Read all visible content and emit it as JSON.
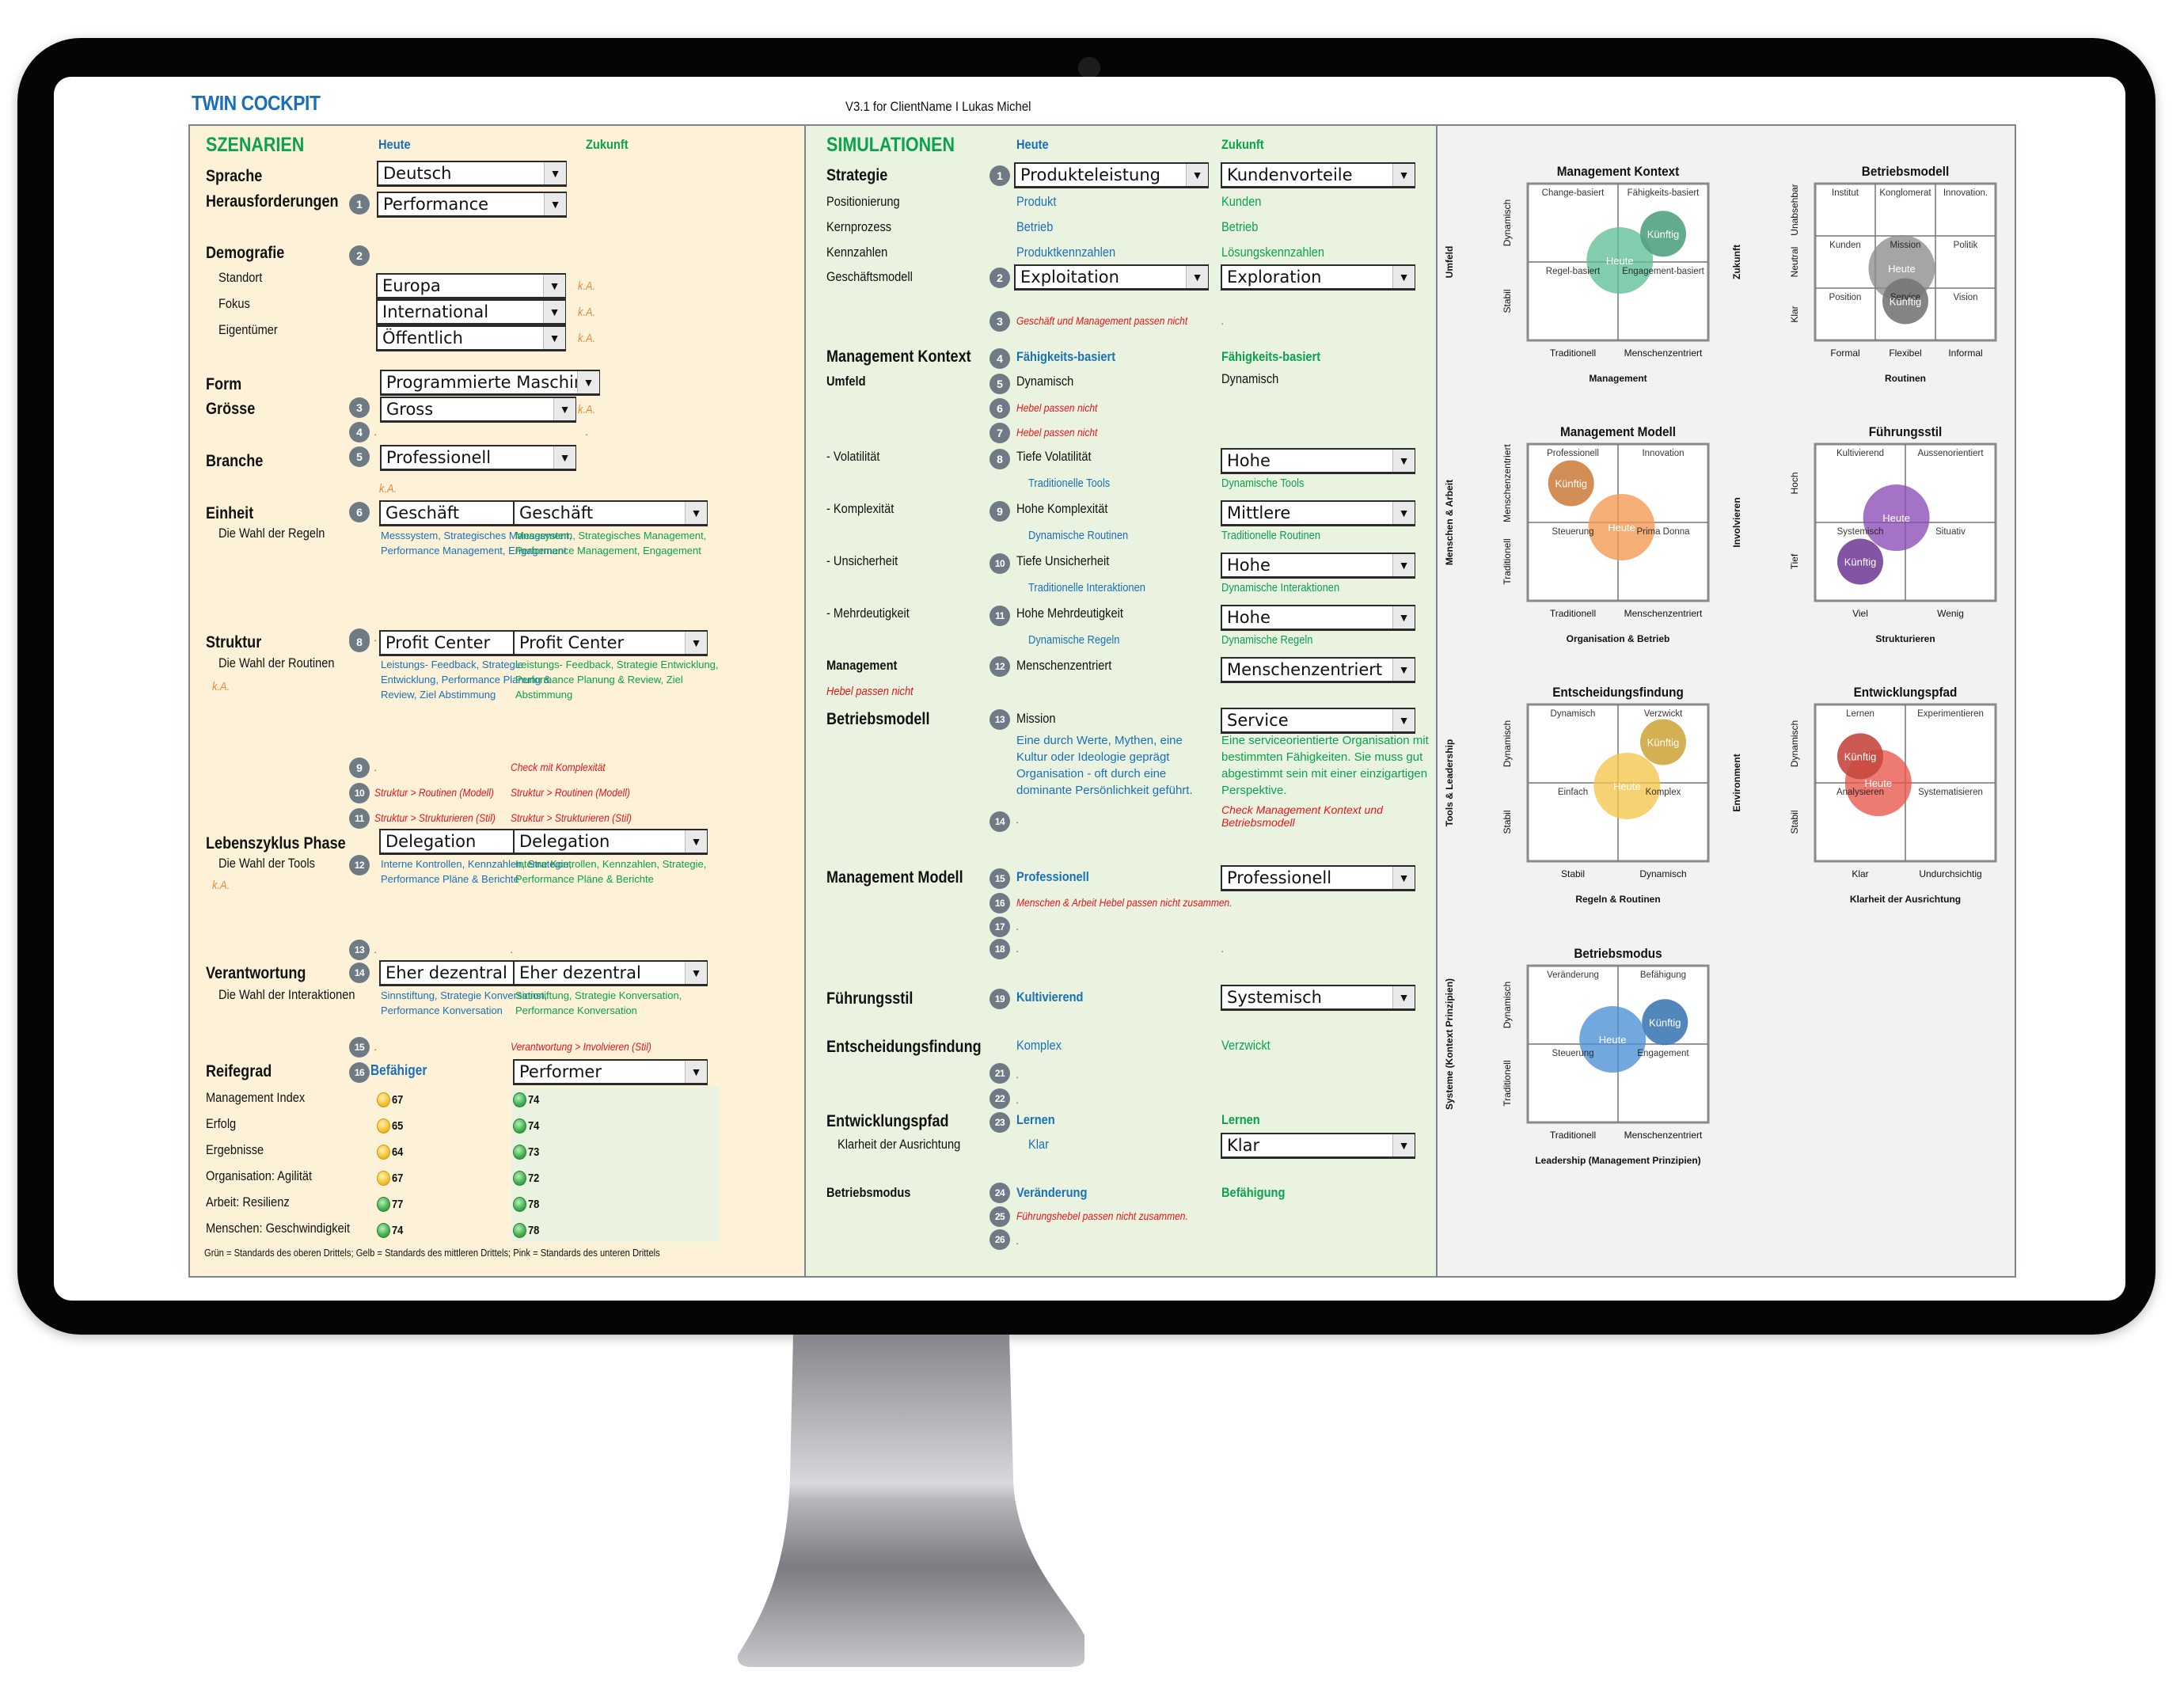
{
  "header": {
    "title": "TWIN COCKPIT",
    "version": "V3.1 for ClientName I Lukas Michel"
  },
  "szenarien": {
    "title": "SZENARIEN",
    "col_heute": "Heute",
    "col_zukunft": "Zukunft",
    "sprache": {
      "label": "Sprache",
      "value": "Deutsch"
    },
    "herausforderungen": {
      "label": "Herausforderungen",
      "badge": "1",
      "value": "Performance"
    },
    "demografie": {
      "label": "Demografie",
      "badge": "2",
      "rows": [
        {
          "label": "Standort",
          "value": "Europa",
          "note": "k.A."
        },
        {
          "label": "Fokus",
          "value": "International",
          "note": "k.A."
        },
        {
          "label": "Eigentümer",
          "value": "Öffentlich",
          "note": "k.A."
        }
      ]
    },
    "form": {
      "label": "Form",
      "value": "Programmierte Maschine"
    },
    "groesse": {
      "label": "Grösse",
      "badge": "3",
      "value": "Gross",
      "note": "k.A."
    },
    "row4": {
      "badge": "4",
      "heute": ".",
      "zukunft": "."
    },
    "branche": {
      "label": "Branche",
      "badge": "5",
      "value": "Professionell",
      "note": "k.A."
    },
    "einheit": {
      "label": "Einheit",
      "sublabel": "Die Wahl der Regeln",
      "badge": "6",
      "heute": "Geschäft",
      "zukunft": "Geschäft",
      "heute_desc": "Messsystem, Strategisches Management, Performance Management, Engagement",
      "zukunft_desc": "Messsystem, Strategisches Management, Performance Management, Engagement"
    },
    "row7": {
      "badge": "7",
      "heute": ".",
      "zukunft": "."
    },
    "struktur": {
      "label": "Struktur",
      "sublabel": "Die Wahl der Routinen",
      "badge": "8",
      "note": "k.A.",
      "heute": "Profit Center",
      "zukunft": "Profit Center",
      "heute_desc": "Leistungs- Feedback, Strategie Entwicklung, Performance Planung & Review, Ziel Abstimmung",
      "zukunft_desc": "Leistungs- Feedback, Strategie Entwicklung, Performance Planung & Review, Ziel Abstimmung"
    },
    "row9": {
      "badge": "9",
      "heute": ".",
      "zukunft": "Check mit Komplexität"
    },
    "row10": {
      "badge": "10",
      "heute": "Struktur > Routinen (Modell)",
      "zukunft": "Struktur > Routinen (Modell)"
    },
    "row11": {
      "badge": "11",
      "heute": "Struktur > Strukturieren (Stil)",
      "zukunft": "Struktur > Strukturieren (Stil)"
    },
    "lebenszyklus": {
      "label": "Lebenszyklus Phase",
      "sublabel": "Die Wahl der Tools",
      "badge": "12",
      "note": "k.A.",
      "heute": "Delegation",
      "zukunft": "Delegation",
      "heute_desc": "Interne Kontrollen, Kennzahlen, Strategie, Performance Pläne & Berichte",
      "zukunft_desc": "Interne Kontrollen, Kennzahlen, Strategie, Performance Pläne & Berichte"
    },
    "row13": {
      "badge": "13",
      "heute": ".",
      "zukunft": "."
    },
    "verantwortung": {
      "label": "Verantwortung",
      "sublabel": "Die Wahl der Interaktionen",
      "badge": "14",
      "heute": "Eher dezentral",
      "zukunft": "Eher dezentral",
      "heute_desc": "Sinnstiftung, Strategie Konversation, Performance Konversation",
      "zukunft_desc": "Sinnstiftung, Strategie Konversation, Performance Konversation"
    },
    "row15": {
      "badge": "15",
      "heute": ".",
      "zukunft": "Verantwortung > Involvieren (Stil)"
    },
    "reifegrad": {
      "label": "Reifegrad",
      "badge": "16",
      "heute": "Befähiger",
      "zukunft": "Performer",
      "metrics": [
        {
          "label": "Management Index",
          "heute": 67,
          "heute_status": "yellow",
          "zukunft": 74,
          "zukunft_status": "green"
        },
        {
          "label": "Erfolg",
          "heute": 65,
          "heute_status": "yellow",
          "zukunft": 74,
          "zukunft_status": "green"
        },
        {
          "label": "Ergebnisse",
          "heute": 64,
          "heute_status": "yellow",
          "zukunft": 73,
          "zukunft_status": "green"
        },
        {
          "label": "Organisation: Agilität",
          "heute": 67,
          "heute_status": "yellow",
          "zukunft": 72,
          "zukunft_status": "green"
        },
        {
          "label": "Arbeit: Resilienz",
          "heute": 77,
          "heute_status": "green",
          "zukunft": 78,
          "zukunft_status": "green"
        },
        {
          "label": "Menschen: Geschwindigkeit",
          "heute": 74,
          "heute_status": "green",
          "zukunft": 78,
          "zukunft_status": "green"
        }
      ],
      "legend": "Grün = Standards des oberen Drittels; Gelb = Standards des mittleren Drittels; Pink = Standards des unteren Drittels"
    }
  },
  "simulationen": {
    "title": "SIMULATIONEN",
    "col_heute": "Heute",
    "col_zukunft": "Zukunft",
    "strategie": {
      "label": "Strategie",
      "badge": "1",
      "heute": "Produkteleistung",
      "zukunft": "Kundenvorteile"
    },
    "positionierung": {
      "label": "Positionierung",
      "heute": "Produkt",
      "zukunft": "Kunden"
    },
    "kernprozess": {
      "label": "Kernprozess",
      "heute": "Betrieb",
      "zukunft": "Betrieb"
    },
    "kennzahlen": {
      "label": "Kennzahlen",
      "heute": "Produktkennzahlen",
      "zukunft": "Lösungskennzahlen"
    },
    "geschaeftsmodell": {
      "label": "Geschäftsmodell",
      "badge": "2",
      "heute": "Exploitation",
      "zukunft": "Exploration"
    },
    "row3": {
      "badge": "3",
      "heute": "Geschäft und Management passen nicht",
      "zukunft": "."
    },
    "management_kontext": {
      "label": "Management Kontext",
      "badge": "4",
      "heute": "Fähigkeits-basiert",
      "zukunft": "Fähigkeits-basiert"
    },
    "umfeld": {
      "label": "Umfeld",
      "badge": "5",
      "heute": "Dynamisch",
      "zukunft": "Dynamisch"
    },
    "row6": {
      "badge": "6",
      "heute": "Hebel passen nicht"
    },
    "row7": {
      "badge": "7",
      "heute": "Hebel passen nicht"
    },
    "volatilitaet": {
      "label": "- Volatilität",
      "badge": "8",
      "heute": "Tiefe Volatilität",
      "zukunft": "Hohe",
      "heute_sub": "Traditionelle Tools",
      "zukunft_sub": "Dynamische Tools"
    },
    "komplexitaet": {
      "label": "- Komplexität",
      "badge": "9",
      "heute": "Hohe Komplexität",
      "zukunft": "Mittlere",
      "heute_sub": "Dynamische Routinen",
      "zukunft_sub": "Traditionelle Routinen"
    },
    "unsicherheit": {
      "label": "- Unsicherheit",
      "badge": "10",
      "heute": "Tiefe Unsicherheit",
      "zukunft": "Hohe",
      "heute_sub": "Traditionelle Interaktionen",
      "zukunft_sub": "Dynamische Interaktionen"
    },
    "mehrdeutigkeit": {
      "label": "- Mehrdeutigkeit",
      "badge": "11",
      "heute": "Hohe Mehrdeutigkeit",
      "zukunft": "Hohe",
      "heute_sub": "Dynamische Regeln",
      "zukunft_sub": "Dynamische Regeln"
    },
    "management": {
      "label": "Management",
      "badge": "12",
      "heute": "Menschenzentriert",
      "zukunft": "Menschenzentriert",
      "warning": "Hebel passen nicht"
    },
    "betriebsmodell": {
      "label": "Betriebsmodell",
      "badge": "13",
      "heute": "Mission",
      "zukunft": "Service",
      "heute_desc": "Eine durch Werte, Mythen, eine Kultur oder Ideologie geprägt Organisation - oft durch eine dominante Persönlichkeit geführt.",
      "zukunft_desc": "Eine serviceorientierte Organisation mit bestimmten Fähigkeiten. Sie muss gut abgestimmt sein mit einer einzigartigen Perspektive."
    },
    "row14": {
      "badge": "14",
      "heute": ".",
      "zukunft": "Check Management Kontext und Betriebsmodell"
    },
    "management_modell": {
      "label": "Management Modell",
      "badge": "15",
      "heute": "Professionell",
      "zukunft": "Professionell"
    },
    "row16": {
      "badge": "16",
      "heute": "Menschen & Arbeit Hebel passen nicht zusammen."
    },
    "row17": {
      "badge": "17",
      "heute": "."
    },
    "row18": {
      "badge": "18",
      "heute": ".",
      "zukunft": "."
    },
    "fuehrungsstil": {
      "label": "Führungsstil",
      "badge": "19",
      "heute": "Kultivierend",
      "zukunft": "Systemisch"
    },
    "entscheidungsfindung": {
      "label": "Entscheidungsfindung",
      "heute": "Komplex",
      "zukunft": "Verzwickt"
    },
    "row21": {
      "badge": "21",
      "heute": "."
    },
    "row22": {
      "badge": "22",
      "heute": "."
    },
    "entwicklungspfad": {
      "label": "Entwicklungspfad",
      "badge": "23",
      "heute": "Lernen",
      "zukunft": "Lernen",
      "sublabel": "Klarheit der Ausrichtung",
      "sub_heute": "Klar",
      "sub_zukunft": "Klar"
    },
    "betriebsmodus": {
      "label": "Betriebsmodus",
      "badge": "24",
      "heute": "Veränderung",
      "zukunft": "Befähigung"
    },
    "row25": {
      "badge": "25",
      "heute": "Führungshebel passen nicht zusammen."
    },
    "row26": {
      "badge": "26",
      "heute": "."
    }
  },
  "chart_data": [
    {
      "type": "scatter",
      "title": "Management Kontext",
      "xlabel": "Management",
      "ylabel": "Umfeld",
      "x_ticks": [
        "Traditionell",
        "Menschenzentriert"
      ],
      "y_ticks": [
        "Stabil",
        "Dynamisch"
      ],
      "grid": [
        2,
        2
      ],
      "cells": [
        [
          "Change-basiert",
          "Fähigkeits-basiert"
        ],
        [
          "Regel-basiert",
          "Engagement-basiert"
        ]
      ],
      "color": "#5fbf96",
      "series": [
        {
          "name": "Heute",
          "x": 0.51,
          "y": 0.51,
          "size": "large"
        },
        {
          "name": "Künftig",
          "x": 0.75,
          "y": 0.68,
          "size": "small"
        }
      ],
      "xlim": [
        0,
        1
      ],
      "ylim": [
        0,
        1
      ]
    },
    {
      "type": "scatter",
      "title": "Betriebsmodell",
      "xlabel": "Routinen",
      "ylabel": "Zukunft",
      "x_ticks": [
        "Formal",
        "Flexibel",
        "Informal"
      ],
      "y_ticks": [
        "Klar",
        "Neutral",
        "Unabsehbar"
      ],
      "grid": [
        3,
        3
      ],
      "cells": [
        [
          "Institut",
          "Konglomerat",
          "Innovation."
        ],
        [
          "Kunden",
          "Mission",
          "Politik"
        ],
        [
          "Position",
          "Service",
          "Vision"
        ]
      ],
      "color": "#8c8c8c",
      "series": [
        {
          "name": "Heute",
          "x": 0.48,
          "y": 0.46,
          "size": "large"
        },
        {
          "name": "Künftig",
          "x": 0.5,
          "y": 0.25,
          "size": "small"
        }
      ],
      "xlim": [
        0,
        1
      ],
      "ylim": [
        0,
        1
      ]
    },
    {
      "type": "scatter",
      "title": "Management Modell",
      "xlabel": "Organisation & Betrieb",
      "ylabel": "Menschen & Arbeit",
      "x_ticks": [
        "Traditionell",
        "Menschenzentriert"
      ],
      "y_ticks": [
        "Traditionell",
        "Menschenzentriert"
      ],
      "grid": [
        2,
        2
      ],
      "cells": [
        [
          "Professionell",
          "Innovation"
        ],
        [
          "Steuerung",
          "Prima Donna"
        ]
      ],
      "color": "#f2994f",
      "series": [
        {
          "name": "Heute",
          "x": 0.52,
          "y": 0.47,
          "size": "large"
        },
        {
          "name": "Künftig",
          "x": 0.24,
          "y": 0.75,
          "size": "small"
        }
      ],
      "xlim": [
        0,
        1
      ],
      "ylim": [
        0,
        1
      ]
    },
    {
      "type": "scatter",
      "title": "Führungsstil",
      "xlabel": "Strukturieren",
      "ylabel": "Involvieren",
      "x_ticks": [
        "Viel",
        "Wenig"
      ],
      "y_ticks": [
        "Tief",
        "Hoch"
      ],
      "grid": [
        2,
        2
      ],
      "cells": [
        [
          "Kultivierend",
          "Aussenorientiert"
        ],
        [
          "Systemisch",
          "Situativ"
        ]
      ],
      "color": "#8a4bb5",
      "series": [
        {
          "name": "Heute",
          "x": 0.45,
          "y": 0.53,
          "size": "large"
        },
        {
          "name": "Künftig",
          "x": 0.25,
          "y": 0.25,
          "size": "small"
        }
      ],
      "xlim": [
        0,
        1
      ],
      "ylim": [
        0,
        1
      ]
    },
    {
      "type": "scatter",
      "title": "Entscheidungsfindung",
      "xlabel": "Regeln & Routinen",
      "ylabel": "Tools & Leadership",
      "x_ticks": [
        "Stabil",
        "Dynamisch"
      ],
      "y_ticks": [
        "Stabil",
        "Dynamisch"
      ],
      "grid": [
        2,
        2
      ],
      "cells": [
        [
          "Dynamisch",
          "Verzwickt"
        ],
        [
          "Einfach",
          "Komplex"
        ]
      ],
      "color": "#f5c54a",
      "series": [
        {
          "name": "Heute",
          "x": 0.55,
          "y": 0.48,
          "size": "large"
        },
        {
          "name": "Künftig",
          "x": 0.75,
          "y": 0.76,
          "size": "small"
        }
      ],
      "xlim": [
        0,
        1
      ],
      "ylim": [
        0,
        1
      ]
    },
    {
      "type": "scatter",
      "title": "Entwicklungspfad",
      "xlabel": "Klarheit der Ausrichtung",
      "ylabel": "Environment",
      "x_ticks": [
        "Klar",
        "Undurchsichtig"
      ],
      "y_ticks": [
        "Stabil",
        "Dynamisch"
      ],
      "grid": [
        2,
        2
      ],
      "cells": [
        [
          "Lernen",
          "Experimentieren"
        ],
        [
          "Analysieren",
          "Systematisieren"
        ]
      ],
      "color": "#e8564a",
      "series": [
        {
          "name": "Heute",
          "x": 0.35,
          "y": 0.5,
          "size": "large"
        },
        {
          "name": "Künftig",
          "x": 0.25,
          "y": 0.67,
          "size": "small"
        }
      ],
      "xlim": [
        0,
        1
      ],
      "ylim": [
        0,
        1
      ]
    },
    {
      "type": "scatter",
      "title": "Betriebsmodus",
      "xlabel": "Leadership (Management Prinzipien)",
      "ylabel": "Systeme (Kontext Prinzipien)",
      "x_ticks": [
        "Traditionell",
        "Menschenzentriert"
      ],
      "y_ticks": [
        "Traditionell",
        "Dynamisch"
      ],
      "grid": [
        2,
        2
      ],
      "cells": [
        [
          "Veränderung",
          "Befähigung"
        ],
        [
          "Steuerung",
          "Engagement"
        ]
      ],
      "color": "#4a8fd4",
      "series": [
        {
          "name": "Heute",
          "x": 0.47,
          "y": 0.53,
          "size": "large"
        },
        {
          "name": "Künftig",
          "x": 0.76,
          "y": 0.64,
          "size": "small"
        }
      ],
      "xlim": [
        0,
        1
      ],
      "ylim": [
        0,
        1
      ]
    }
  ]
}
